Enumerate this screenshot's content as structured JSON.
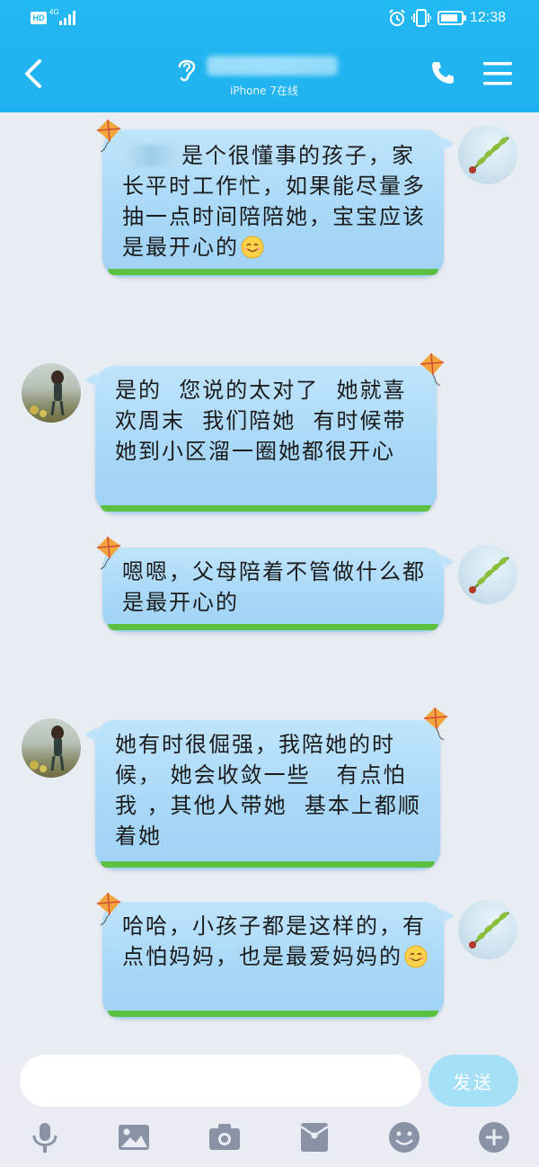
{
  "status_bar": {
    "hd": "HD",
    "network": "4G",
    "time": "12:38"
  },
  "header": {
    "contact_name": "",
    "contact_status": "iPhone 7在线"
  },
  "messages": [
    {
      "side": "right",
      "text_after_redaction": "是个很懂事的孩子，家长平时工作忙，如果能尽量多抽一点时间陪陪她，宝宝应该是最开心的",
      "emoji": "smile-emoji"
    },
    {
      "side": "left",
      "text": "是的  您说的太对了  她就喜欢周末  我们陪她  有时候带她到小区溜一圈她都很开心"
    },
    {
      "side": "right",
      "text": "嗯嗯，父母陪着不管做什么都是最开心的"
    },
    {
      "side": "left",
      "text": "她有时很倔强，我陪她的时候， 她会收敛一些   有点怕我 ，其他人带她  基本上都顺着她"
    },
    {
      "side": "right",
      "text": "哈哈，小孩子都是这样的，有点怕妈妈，也是最爱妈妈的",
      "emoji": "smile-emoji"
    }
  ],
  "composer": {
    "input_value": "",
    "send_label": "发送"
  },
  "toolbar": {
    "icons": [
      "microphone-icon",
      "image-icon",
      "camera-icon",
      "red-packet-icon",
      "emoji-icon",
      "plus-icon"
    ]
  },
  "colors": {
    "header": "#22b8f2",
    "bubble": "#a9d8f7",
    "grass": "#5cc040",
    "send_button": "#a6e0f7",
    "background": "#e8ecf3"
  }
}
